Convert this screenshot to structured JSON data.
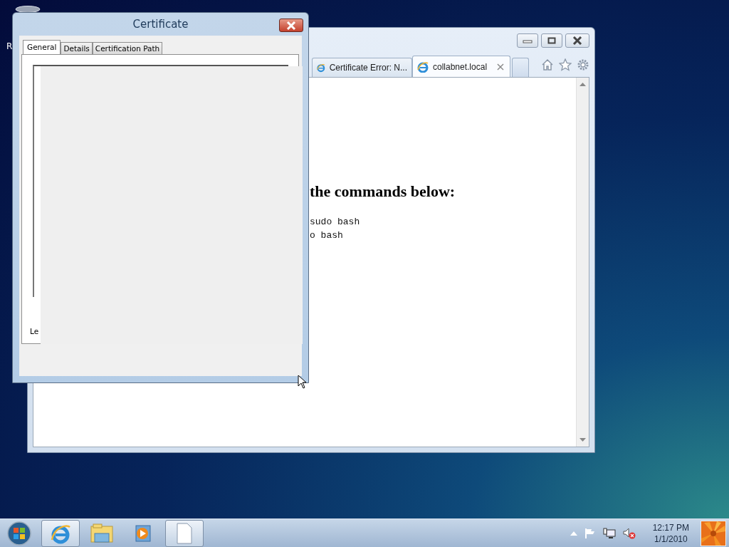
{
  "desktop": {
    "icon_label": "R"
  },
  "browser": {
    "tabs": [
      {
        "label": "Certificate Error: N...",
        "selected": false
      },
      {
        "label": "collabnet.local",
        "selected": true,
        "close": "×"
      }
    ],
    "heading": "the commands below:",
    "code_lines": [
      "sudo bash",
      "o bash"
    ]
  },
  "dialog": {
    "title": "Certificate",
    "tabs": [
      {
        "label": "General",
        "selected": true
      },
      {
        "label": "Details",
        "selected": false
      },
      {
        "label": "Certification Path",
        "selected": false
      }
    ],
    "partial_label": "Le"
  },
  "taskbar": {
    "apps": [
      {
        "kind": "ie",
        "running": true
      },
      {
        "kind": "folder",
        "running": false
      },
      {
        "kind": "media",
        "running": false
      },
      {
        "kind": "document",
        "running": true
      }
    ],
    "clock": {
      "time": "12:17 PM",
      "date": "1/1/2010"
    }
  }
}
